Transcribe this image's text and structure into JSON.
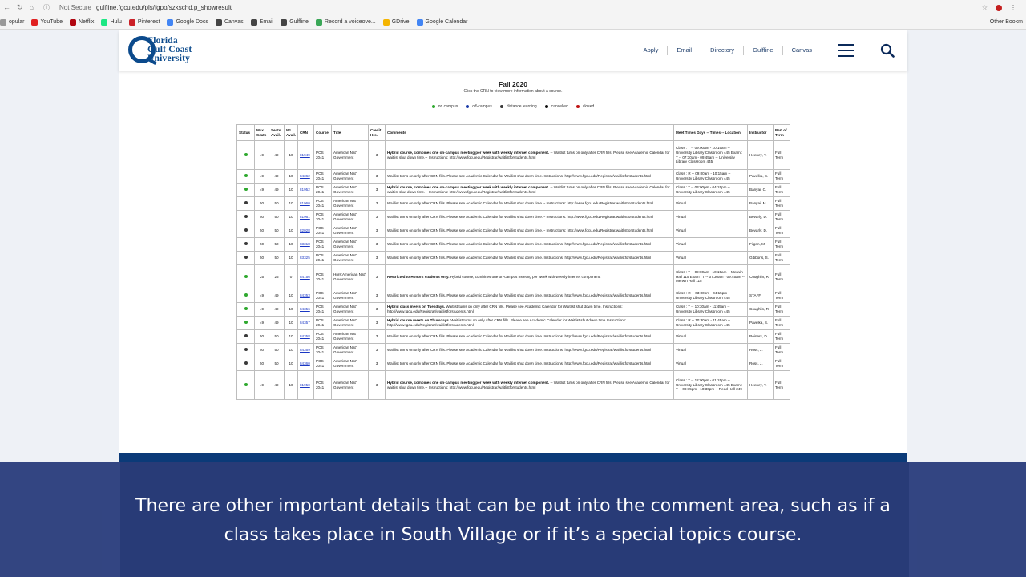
{
  "browser": {
    "security": "Not Secure",
    "url": "gulfline.fgcu.edu/pls/fgpo/szkschd.p_showresult"
  },
  "bookmarks": [
    {
      "label": "opular",
      "color": "#999999"
    },
    {
      "label": "YouTube",
      "color": "#e02020"
    },
    {
      "label": "Netflix",
      "color": "#b00610"
    },
    {
      "label": "Hulu",
      "color": "#1ce783"
    },
    {
      "label": "Pinterest",
      "color": "#cb2027"
    },
    {
      "label": "Google Docs",
      "color": "#4285f4"
    },
    {
      "label": "Canvas",
      "color": "#444444"
    },
    {
      "label": "Email",
      "color": "#444444"
    },
    {
      "label": "Gulfline",
      "color": "#444444"
    },
    {
      "label": "Record a voiceove...",
      "color": "#3aa757"
    },
    {
      "label": "GDrive",
      "color": "#f4b400"
    },
    {
      "label": "Google Calendar",
      "color": "#4285f4"
    }
  ],
  "other_bookmarks": "Other Bookm",
  "logo": {
    "line1": "Florida",
    "line2": "Gulf Coast",
    "line3": "University"
  },
  "nav": [
    "Apply",
    "Email",
    "Directory",
    "Gulfline",
    "Canvas"
  ],
  "schedule": {
    "term": "Fall 2020",
    "instruction": "Click the CRN to view more information about a course.",
    "legend": [
      {
        "label": "on campus",
        "color": "#2ea82e"
      },
      {
        "label": "off-campus",
        "color": "#1a3aa8"
      },
      {
        "label": "distance learning",
        "color": "#3a3a3a"
      },
      {
        "label": "cancelled",
        "color": "#111111"
      },
      {
        "label": "closed",
        "color": "#c01515"
      }
    ],
    "headers": [
      "Status",
      "Max Seats",
      "Seats Avail.",
      "WL Avail.",
      "CRN",
      "Course",
      "Title",
      "Credit Hrs.",
      "Comments",
      "Meet Times Days -- Times -- Location",
      "Instructor",
      "Part of Term"
    ],
    "rows": [
      {
        "status": "#2ea82e",
        "max": "49",
        "avail": "49",
        "wl": "10",
        "crn": "81949",
        "course": "POS 2041",
        "title": "American Nat'l Government",
        "credit": "3",
        "bold": "Hybrid course, combines one on-campus meeting per week with weekly internet component.",
        "comment": "-- Waitlist turns on only after CRN fills. Please see Academic Calendar for waitlist shut down time.-- Instructions: http://www.fgcu.edu/Registrar/waitlistforstudents.html",
        "meet": "Class : T -- 09:00am - 10:15am -- University Library Classroom 445   Exam : T -- 07:30am - 09:45am -- University Library Classroom 445",
        "instructor": "Heeney, T.",
        "part": "Full Term",
        "size": "tall"
      },
      {
        "status": "#2ea82e",
        "max": "49",
        "avail": "49",
        "wl": "10",
        "crn": "84362",
        "course": "POS 2041",
        "title": "American Nat'l Government",
        "credit": "3",
        "bold": "",
        "comment": "Waitlist turns on only after CRN fills. Please see Academic Calendar for Waitlist shut down time. Instructions: http://www.fgcu.edu/Registrar/waitlistforstudents.html",
        "meet": "Class : R -- 09:00am - 10:15am -- University Library Classroom 445",
        "instructor": "Pavelka, S.",
        "part": "Full Term",
        "size": ""
      },
      {
        "status": "#2ea82e",
        "max": "49",
        "avail": "49",
        "wl": "10",
        "crn": "81952",
        "course": "POS 2041",
        "title": "American Nat'l Government",
        "credit": "3",
        "bold": "Hybrid course, combines one on-campus meeting per week with weekly internet component.",
        "comment": "-- Waitlist turns on only after CRN fills. Please see Academic Calendar for waitlist shut down time.-- Instructions: http://www.fgcu.edu/Registrar/waitlistforstudents.html",
        "meet": "Class : T -- 03:00pm - 04:15pm -- University Library Classroom 445",
        "instructor": "Banyai, C.",
        "part": "Full Term",
        "size": ""
      },
      {
        "status": "#3a3a3a",
        "max": "50",
        "avail": "50",
        "wl": "10",
        "crn": "81960",
        "course": "POS 2041",
        "title": "American Nat'l Government",
        "credit": "3",
        "bold": "",
        "comment": "Waitlist turns on only after CRN fills. Please see Academic Calendar for Waitlist shut down time.-- Instructions: http://www.fgcu.edu/Registrar/waitlistforstudents.html",
        "meet": "Virtual",
        "instructor": "Banyai, M.",
        "part": "Full Term",
        "size": ""
      },
      {
        "status": "#3a3a3a",
        "max": "50",
        "avail": "50",
        "wl": "10",
        "crn": "81961",
        "course": "POS 2041",
        "title": "American Nat'l Government",
        "credit": "3",
        "bold": "",
        "comment": "Waitlist turns on only after CRN fills. Please see Academic Calendar for Waitlist shut down time.-- Instructions: http://www.fgcu.edu/Registrar/waitlistforstudents.html",
        "meet": "Virtual",
        "instructor": "Bevarly, D.",
        "part": "Full Term",
        "size": ""
      },
      {
        "status": "#3a3a3a",
        "max": "50",
        "avail": "50",
        "wl": "10",
        "crn": "82028",
        "course": "POS 2041",
        "title": "American Nat'l Government",
        "credit": "3",
        "bold": "",
        "comment": "Waitlist turns on only after CRN fills. Please see Academic Calendar for Waitlist shut down time.-- Instructions: http://www.fgcu.edu/Registrar/waitlistforstudents.html",
        "meet": "Virtual",
        "instructor": "Bevarly, D.",
        "part": "Full Term",
        "size": ""
      },
      {
        "status": "#3a3a3a",
        "max": "50",
        "avail": "50",
        "wl": "10",
        "crn": "83318",
        "course": "POS 2041",
        "title": "American Nat'l Government",
        "credit": "3",
        "bold": "",
        "comment": "Waitlist turns on only after CRN fills. Please see Academic Calendar for Waitlist shut down time. Instructions: http://www.fgcu.edu/Registrar/waitlistforstudents.html",
        "meet": "Virtual",
        "instructor": "Filgon, M.",
        "part": "Full Term",
        "size": ""
      },
      {
        "status": "#3a3a3a",
        "max": "50",
        "avail": "50",
        "wl": "10",
        "crn": "83325",
        "course": "POS 2041",
        "title": "American Nat'l Government",
        "credit": "3",
        "bold": "",
        "comment": "Waitlist turns on only after CRN fills. Please see Academic Calendar for Waitlist shut down time. Instructions: http://www.fgcu.edu/Registrar/waitlistforstudents.html",
        "meet": "Virtual",
        "instructor": "Gibbons, S.",
        "part": "Full Term",
        "size": ""
      },
      {
        "status": "#2ea82e",
        "max": "25",
        "avail": "25",
        "wl": "0",
        "crn": "84156",
        "course": "POS 2041",
        "title": "Hnrs:American Nat'l Government",
        "credit": "3",
        "bold": "Restricted to Honors students only.",
        "comment": "Hybrid course, combines one on-campus meeting per week with weekly internet component.",
        "meet": "Class : T -- 09:00am - 10:15am -- Merwin Hall 115   Exam : T -- 07:30am - 09:45am -- Merwin Hall 115",
        "instructor": "Coughlin, R.",
        "part": "Full Term",
        "size": "tall2"
      },
      {
        "status": "#2ea82e",
        "max": "49",
        "avail": "49",
        "wl": "10",
        "crn": "84353",
        "course": "POS 2041",
        "title": "American Nat'l Government",
        "credit": "3",
        "bold": "",
        "comment": "Waitlist turns on only after CRN fills. Please see Academic Calendar for Waitlist shut down time. Instructions: http://www.fgcu.edu/Registrar/waitlistforstudents.html",
        "meet": "Class : R -- 03:00pm - 04:15pm -- University Library Classroom 445",
        "instructor": "STAFF",
        "part": "Full Term",
        "size": ""
      },
      {
        "status": "#2ea82e",
        "max": "49",
        "avail": "49",
        "wl": "10",
        "crn": "84356",
        "course": "POS 2041",
        "title": "American Nat'l Government",
        "credit": "3",
        "bold": "Hybrid class meets on Tuesdays.",
        "comment": "Waitlist turns on only after CRN fills. Please see Academic Calendar for Waitlist shut down time. Instructions: http://www.fgcu.edu/Registrar/waitlistforstudents.html",
        "meet": "Class : T -- 10:30am - 11:45am -- University Library Classroom 445",
        "instructor": "Coughlin, R.",
        "part": "Full Term",
        "size": ""
      },
      {
        "status": "#2ea82e",
        "max": "49",
        "avail": "49",
        "wl": "10",
        "crn": "84357",
        "course": "POS 2041",
        "title": "American Nat'l Government",
        "credit": "3",
        "bold": "Hybrid course meets on Thursdays.",
        "comment": "Waitlist turns on only after CRN fills. Please see Academic Calendar for Waitlist shut down time Instructions: http://www.fgcu.edu/Registrar/waitlistforstudents.html",
        "meet": "Class : R -- 10:30am - 11:45am -- University Library Classroom 445",
        "instructor": "Pavelka, S.",
        "part": "Full Term",
        "size": ""
      },
      {
        "status": "#3a3a3a",
        "max": "50",
        "avail": "50",
        "wl": "10",
        "crn": "84358",
        "course": "POS 2041",
        "title": "American Nat'l Government",
        "credit": "3",
        "bold": "",
        "comment": "Waitlist turns on only after CRN fills. Please see Academic Calendar for Waitlist shut down time. Instructions: http://www.fgcu.edu/Registrar/waitlistforstudents.html",
        "meet": "Virtual",
        "instructor": "Reiners, D.",
        "part": "Full Term",
        "size": ""
      },
      {
        "status": "#3a3a3a",
        "max": "50",
        "avail": "50",
        "wl": "10",
        "crn": "84359",
        "course": "POS 2041",
        "title": "American Nat'l Government",
        "credit": "3",
        "bold": "",
        "comment": "Waitlist turns on only after CRN fills. Please see Academic Calendar for Waitlist shut down time. Instructions: http://www.fgcu.edu/Registrar/waitlistforstudents.html",
        "meet": "Virtual",
        "instructor": "Ross, J.",
        "part": "Full Term",
        "size": ""
      },
      {
        "status": "#3a3a3a",
        "max": "50",
        "avail": "50",
        "wl": "10",
        "crn": "84360",
        "course": "POS 2041",
        "title": "American Nat'l Government",
        "credit": "3",
        "bold": "",
        "comment": "Waitlist turns on only after CRN fills. Please see Academic Calendar for Waitlist shut down time. Instructions: http://www.fgcu.edu/Registrar/waitlistforstudents.html",
        "meet": "Virtual",
        "instructor": "Ross, J.",
        "part": "Full Term",
        "size": ""
      },
      {
        "status": "#2ea82e",
        "max": "49",
        "avail": "49",
        "wl": "10",
        "crn": "81950",
        "course": "POS 2041",
        "title": "American Nat'l Government",
        "credit": "3",
        "bold": "Hybrid course, combines one on-campus meeting per week with weekly internet component.",
        "comment": "-- Waitlist turns on only after CRN fills. Please see Academic Calendar for waitlist shut down time.-- Instructions: http://www.fgcu.edu/Registrar/waitlistforstudents.html",
        "meet": "Class : T -- 12:00pm - 01:15pm -- University Library Classroom 445   Exam : T -- 08:15pm - 10:30pm -- Reed Hall 249",
        "instructor": "Heeney, T.",
        "part": "Full Term",
        "size": "tall"
      }
    ]
  },
  "caption": "There are other important details that can be put into the comment area, such as if a class takes place in South Village or if it’s a special topics course."
}
